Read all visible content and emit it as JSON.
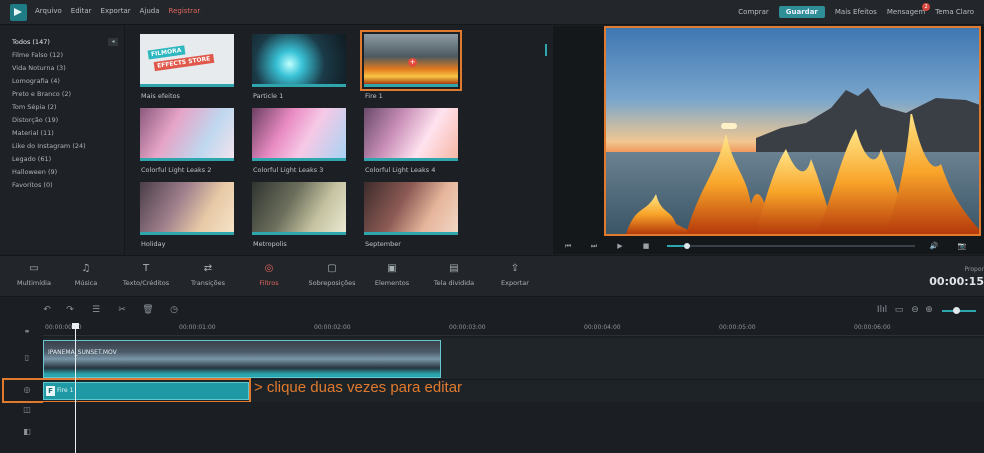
{
  "menu": {
    "items": [
      "Arquivo",
      "Editar",
      "Exportar",
      "Ajuda"
    ],
    "register": "Registrar"
  },
  "top_right": {
    "buy": "Comprar",
    "save": "Guardar",
    "more_effects": "Mais Efeitos",
    "messages": "Mensagem",
    "messages_badge": "2",
    "theme": "Tema Claro"
  },
  "library": {
    "collapse_icon": "◂",
    "categories": [
      "Todos (147)",
      "Filme Falso (12)",
      "Vida Noturna (3)",
      "Lomografia (4)",
      "Preto e Branco (2)",
      "Tom Sépia (2)",
      "Distorção (19)",
      "Material (11)",
      "Like do Instagram (24)",
      "Legado (61)",
      "Halloween (9)",
      "Favoritos (0)"
    ]
  },
  "effects": [
    {
      "label": "Mais efeitos",
      "store_line1": "FILMORA",
      "store_line2": "EFFECTS STORE"
    },
    {
      "label": "Particle 1"
    },
    {
      "label": "Fire 1",
      "add_icon": "+"
    },
    {
      "label": "Colorful Light Leaks 2"
    },
    {
      "label": "Colorful Light Leaks 3"
    },
    {
      "label": "Colorful Light Leaks 4"
    },
    {
      "label": "Holiday"
    },
    {
      "label": "Metropolis"
    },
    {
      "label": "September"
    }
  ],
  "player": {
    "progress": 0.08,
    "icons": {
      "prev": "⏮",
      "next": "⏭",
      "play": "▶",
      "stop": "■",
      "volume": "🔊",
      "snapshot": "📷"
    }
  },
  "toolbar": {
    "tools": [
      {
        "label": "Multimídia",
        "icon": "▭"
      },
      {
        "label": "Música",
        "icon": "♫"
      },
      {
        "label": "Texto/Créditos",
        "icon": "T"
      },
      {
        "label": "Transições",
        "icon": "⇄"
      },
      {
        "label": "Filtros",
        "icon": "◎"
      },
      {
        "label": "Sobreposições",
        "icon": "▢"
      },
      {
        "label": "Elementos",
        "icon": "▣"
      },
      {
        "label": "Tela dividida",
        "icon": "▤"
      },
      {
        "label": "Exportar",
        "icon": "⇪"
      }
    ],
    "export_info_label": "Propor",
    "timecode": "00:00:15"
  },
  "timeline": {
    "tool_icons": {
      "undo": "↶",
      "redo": "↷",
      "adjust": "☰",
      "cut": "✂",
      "delete": "🗑",
      "speed": "◷",
      "audio": "Ilıl",
      "fit": "▭",
      "zoom_out": "⊖",
      "zoom_in": "⊕"
    },
    "ruler": [
      "00:00:00:00",
      "00:00:01:00",
      "00:00:02:00",
      "00:00:03:00",
      "00:00:04:00",
      "00:00:05:00",
      "00:00:06:00"
    ],
    "video_clip_name": "IPANEMA_SUNSET.MOV",
    "filter_clip_name": "Fire 1",
    "filter_badge": "F",
    "annotation": "> clique duas vezes para editar",
    "track_icons": {
      "link": "⚭",
      "video": "▯",
      "filter": "◎",
      "overlay": "◫",
      "audio": "◧"
    },
    "zoom_level": 0.4
  }
}
